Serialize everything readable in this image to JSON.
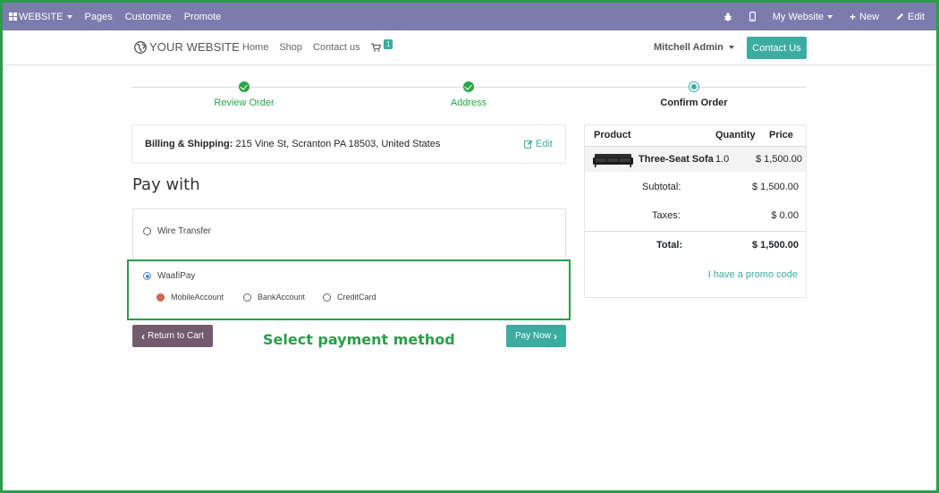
{
  "adminbar": {
    "website_menu": "WEBSITE",
    "pages": "Pages",
    "customize": "Customize",
    "promote": "Promote",
    "my_website": "My Website",
    "new": "New",
    "edit": "Edit"
  },
  "header": {
    "logo_text": "YOUR WEBSITE",
    "nav": [
      "Home",
      "Shop",
      "Contact us"
    ],
    "cart_count": "1",
    "user": "Mitchell Admin",
    "contact_button": "Contact Us"
  },
  "steps": [
    {
      "label": "Review Order",
      "state": "done"
    },
    {
      "label": "Address",
      "state": "done"
    },
    {
      "label": "Confirm Order",
      "state": "current"
    }
  ],
  "billing": {
    "label": "Billing & Shipping:",
    "address": "215 Vine St, Scranton PA 18503, United States",
    "edit": "Edit"
  },
  "pay_with": "Pay with",
  "payment": {
    "wire_transfer": "Wire Transfer",
    "waafipay": "WaafiPay",
    "sub_options": [
      "MobileAccount",
      "BankAccount",
      "CreditCard"
    ]
  },
  "buttons": {
    "return": "Return to Cart",
    "pay_now": "Pay Now"
  },
  "annotation": "Select payment method",
  "summary": {
    "headers": {
      "product": "Product",
      "quantity": "Quantity",
      "price": "Price"
    },
    "item": {
      "name": "Three-Seat Sofa",
      "quantity": "1.0",
      "price": "$ 1,500.00"
    },
    "subtotal_label": "Subtotal:",
    "subtotal": "$ 1,500.00",
    "taxes_label": "Taxes:",
    "taxes": "$ 0.00",
    "total_label": "Total:",
    "total": "$ 1,500.00",
    "promo": "I have a promo code"
  },
  "colors": {
    "adminbar": "#7c7bad",
    "accent": "#3aada0",
    "success": "#28a745",
    "annotation": "#2a9d4a",
    "return_button": "#725b6d"
  }
}
